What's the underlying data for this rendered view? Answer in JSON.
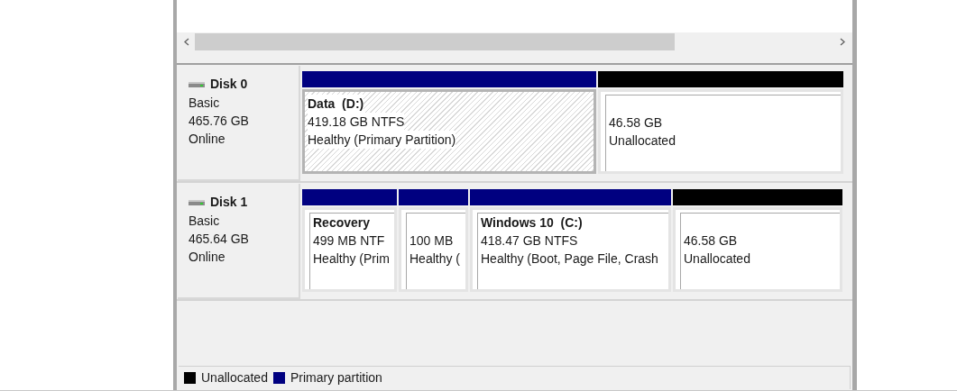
{
  "disks": [
    {
      "name": "Disk 0",
      "type": "Basic",
      "size": "465.76 GB",
      "status": "Online",
      "partitions": [
        {
          "kind": "primary",
          "selected": true,
          "name": "Data  (D:)",
          "size": "419.18 GB NTFS",
          "status": "Healthy (Primary Partition)"
        },
        {
          "kind": "unallocated",
          "selected": false,
          "size": "46.58 GB",
          "status": "Unallocated"
        }
      ]
    },
    {
      "name": "Disk 1",
      "type": "Basic",
      "size": "465.64 GB",
      "status": "Online",
      "partitions": [
        {
          "kind": "primary",
          "selected": false,
          "name": "Recovery",
          "size": "499 MB NTF",
          "status": "Healthy (Prim"
        },
        {
          "kind": "primary",
          "selected": false,
          "size": "100 MB",
          "status": "Healthy ("
        },
        {
          "kind": "primary",
          "selected": false,
          "name": "Windows 10  (C:)",
          "size": "418.47 GB NTFS",
          "status": "Healthy (Boot, Page File, Crash"
        },
        {
          "kind": "unallocated",
          "selected": false,
          "size": "46.58 GB",
          "status": "Unallocated"
        }
      ]
    }
  ],
  "legend": [
    {
      "label": "Unallocated",
      "color": "#000000"
    },
    {
      "label": "Primary partition",
      "color": "#000080"
    }
  ]
}
